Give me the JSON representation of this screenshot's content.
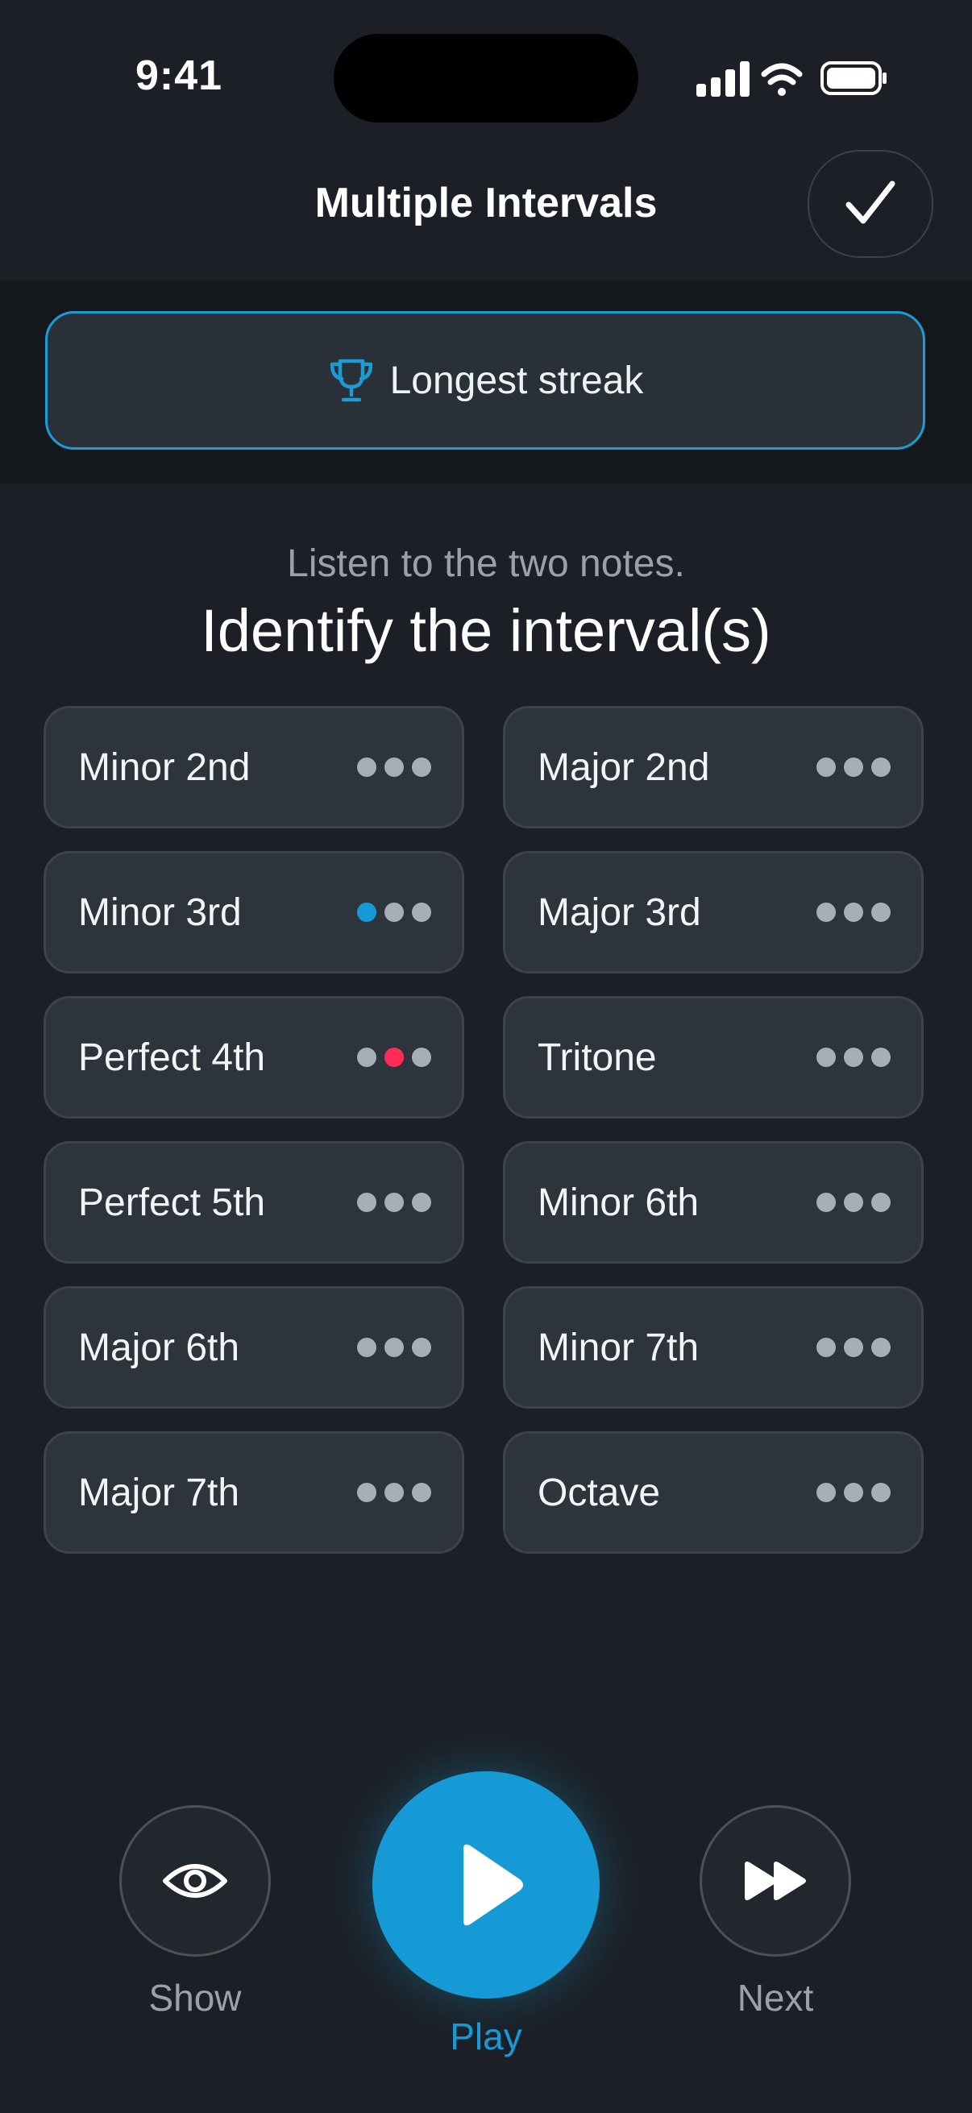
{
  "status_bar": {
    "time": "9:41"
  },
  "header": {
    "title": "Multiple Intervals",
    "done_icon": "checkmark-icon"
  },
  "streak": {
    "label": "Longest streak",
    "icon": "trophy-icon"
  },
  "instruction": "Listen to the two notes.",
  "prompt": "Identify the interval(s)",
  "colors": {
    "accent": "#169ad6",
    "error": "#ff2d55",
    "dot_default": "#a8aeb6",
    "background": "#1c2026"
  },
  "intervals": [
    {
      "label": "Minor 2nd",
      "dots": [
        "gray",
        "gray",
        "gray"
      ]
    },
    {
      "label": "Major 2nd",
      "dots": [
        "gray",
        "gray",
        "gray"
      ]
    },
    {
      "label": "Minor 3rd",
      "dots": [
        "blue",
        "gray",
        "gray"
      ]
    },
    {
      "label": "Major 3rd",
      "dots": [
        "gray",
        "gray",
        "gray"
      ]
    },
    {
      "label": "Perfect 4th",
      "dots": [
        "gray",
        "red",
        "gray"
      ]
    },
    {
      "label": "Tritone",
      "dots": [
        "gray",
        "gray",
        "gray"
      ]
    },
    {
      "label": "Perfect 5th",
      "dots": [
        "gray",
        "gray",
        "gray"
      ]
    },
    {
      "label": "Minor 6th",
      "dots": [
        "gray",
        "gray",
        "gray"
      ]
    },
    {
      "label": "Major 6th",
      "dots": [
        "gray",
        "gray",
        "gray"
      ]
    },
    {
      "label": "Minor 7th",
      "dots": [
        "gray",
        "gray",
        "gray"
      ]
    },
    {
      "label": "Major 7th",
      "dots": [
        "gray",
        "gray",
        "gray"
      ]
    },
    {
      "label": "Octave",
      "dots": [
        "gray",
        "gray",
        "gray"
      ]
    }
  ],
  "controls": {
    "show_label": "Show",
    "play_label": "Play",
    "next_label": "Next"
  }
}
